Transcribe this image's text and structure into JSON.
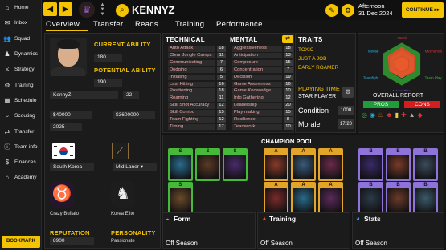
{
  "sidebar": {
    "items": [
      {
        "label": "Home",
        "icon": "home-icon",
        "glyph": "⌂"
      },
      {
        "label": "Inbox",
        "icon": "inbox-icon",
        "glyph": "✉"
      },
      {
        "label": "Squad",
        "icon": "squad-icon",
        "glyph": "👥"
      },
      {
        "label": "Dynamics",
        "icon": "dynamics-icon",
        "glyph": "♟"
      },
      {
        "label": "Strategy",
        "icon": "strategy-icon",
        "glyph": "⚔"
      },
      {
        "label": "Training",
        "icon": "training-icon",
        "glyph": "⚙"
      },
      {
        "label": "Schedule",
        "icon": "schedule-icon",
        "glyph": "▦"
      },
      {
        "label": "Scouting",
        "icon": "scouting-icon",
        "glyph": "⌕"
      },
      {
        "label": "Transfer",
        "icon": "transfer-icon",
        "glyph": "⇄"
      },
      {
        "label": "Team info",
        "icon": "team-info-icon",
        "glyph": "ⓘ"
      },
      {
        "label": "Finances",
        "icon": "finances-icon",
        "glyph": "$"
      },
      {
        "label": "Academy",
        "icon": "academy-icon",
        "glyph": "⌂"
      }
    ],
    "bookmark": "BOOKMARK"
  },
  "topbar": {
    "player_name": "KENNYZ",
    "time_of_day": "Afternoon",
    "date": "31 Dec 2024",
    "continue_label": "CONTINUE"
  },
  "tabs": [
    "Overview",
    "Transfer",
    "Reads",
    "Training",
    "Performance"
  ],
  "profile": {
    "current_ability_label": "CURRENT ABILITY",
    "current_ability": "180",
    "potential_ability_label": "POTENTIAL ABILITY",
    "potential_ability": "190",
    "nickname": "KennyZ",
    "age": "22",
    "value": "$40000",
    "wage": "$3600000",
    "contract": "2025",
    "nationality": "South Korea",
    "position": "Mid Laner",
    "team_left": "Crazy Buffalo",
    "team_right": "Korea Elite",
    "reputation_label": "REPUTATION",
    "reputation": "8900",
    "personality_label": "PERSONALITY",
    "personality": "Passionate"
  },
  "attributes": {
    "technical_label": "TECHNICAL",
    "mental_label": "MENTAL",
    "technical": [
      {
        "name": "Auto Attack",
        "value": "18"
      },
      {
        "name": "Clear Jungle Camps",
        "value": "11"
      },
      {
        "name": "Communicating",
        "value": "7"
      },
      {
        "name": "Dodging",
        "value": "6"
      },
      {
        "name": "Initiating",
        "value": "5"
      },
      {
        "name": "Last Hitting",
        "value": "16"
      },
      {
        "name": "Positioning",
        "value": "18"
      },
      {
        "name": "Roaming",
        "value": "11"
      },
      {
        "name": "Skill Shot Accuracy",
        "value": "12"
      },
      {
        "name": "Skill Combo",
        "value": "15"
      },
      {
        "name": "Team Fighting",
        "value": "12"
      },
      {
        "name": "Timing",
        "value": "17"
      }
    ],
    "mental": [
      {
        "name": "Aggressiveness",
        "value": "18"
      },
      {
        "name": "Anticipation",
        "value": "13"
      },
      {
        "name": "Composure",
        "value": "15"
      },
      {
        "name": "Concentration",
        "value": "7"
      },
      {
        "name": "Decision",
        "value": "19"
      },
      {
        "name": "Game Awareness",
        "value": "16"
      },
      {
        "name": "Game Knowledge",
        "value": "10"
      },
      {
        "name": "Info Gathering",
        "value": "12"
      },
      {
        "name": "Leadership",
        "value": "20"
      },
      {
        "name": "Play making",
        "value": "15"
      },
      {
        "name": "Resilience",
        "value": "8"
      },
      {
        "name": "Teamwork",
        "value": "10"
      }
    ]
  },
  "traits": {
    "label": "TRAITS",
    "items": [
      "TOXIC",
      "JUST A JOB",
      "EARLY ROAMER"
    ],
    "playing_time_label": "PLAYING TIME",
    "playing_time": "STAR PLAYER",
    "condition_label": "Condition",
    "condition": "1000",
    "morale_label": "Morale",
    "morale": "17/20"
  },
  "radar": {
    "labels": [
      "Attack",
      "Mechanics",
      "Team Play",
      "Macro Play",
      "Teamfight",
      "Mental"
    ],
    "levels": [
      0.8,
      0.72,
      0.7,
      0.62,
      0.68,
      0.75
    ],
    "color": "#e84b2a"
  },
  "overall_report": {
    "label": "OVERALL REPORT",
    "pros_label": "PROS",
    "cons_label": "CONS",
    "pros_color": "#1f9d3a",
    "cons_color": "#d41d1d"
  },
  "champion_pool": {
    "label": "CHAMPION POOL",
    "s_tier_label": "S",
    "a_tier_label": "A",
    "b_tier_label": "B",
    "s_color": "#46b83a",
    "a_color": "#e2a52a",
    "b_color": "#8e73d8"
  },
  "footer": {
    "form_label": "Form",
    "training_label": "Training",
    "stats_label": "Stats",
    "off_season": "Off Season"
  }
}
